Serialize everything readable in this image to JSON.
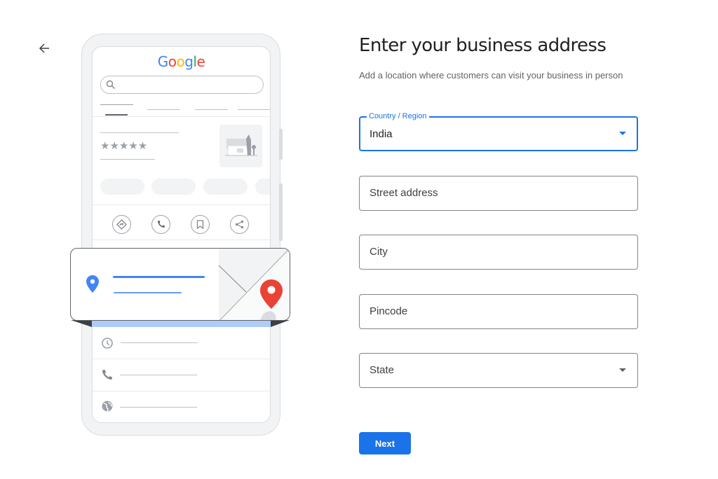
{
  "nav": {
    "back_icon": "arrow-back-icon"
  },
  "illustration": {
    "logo_letters": [
      "G",
      "o",
      "o",
      "g",
      "l",
      "e"
    ],
    "rating_stars": "★★★★★",
    "action_icons": [
      "directions-icon",
      "phone-icon",
      "bookmark-icon",
      "share-icon"
    ],
    "info_row_icons": [
      "clock-icon",
      "phone-icon",
      "globe-icon"
    ]
  },
  "form": {
    "title": "Enter your business address",
    "subtitle": "Add a location where customers can visit your business in person",
    "fields": {
      "country": {
        "label": "Country / Region",
        "value": "India"
      },
      "street": {
        "placeholder": "Street address",
        "value": ""
      },
      "city": {
        "placeholder": "City",
        "value": ""
      },
      "pincode": {
        "placeholder": "Pincode",
        "value": ""
      },
      "state": {
        "placeholder": "State",
        "value": ""
      }
    },
    "next_label": "Next"
  },
  "colors": {
    "accent": "#1a73e8",
    "pin_blue": "#4285f4",
    "pin_red": "#ea4335",
    "ribbon": "#aecbfa"
  }
}
